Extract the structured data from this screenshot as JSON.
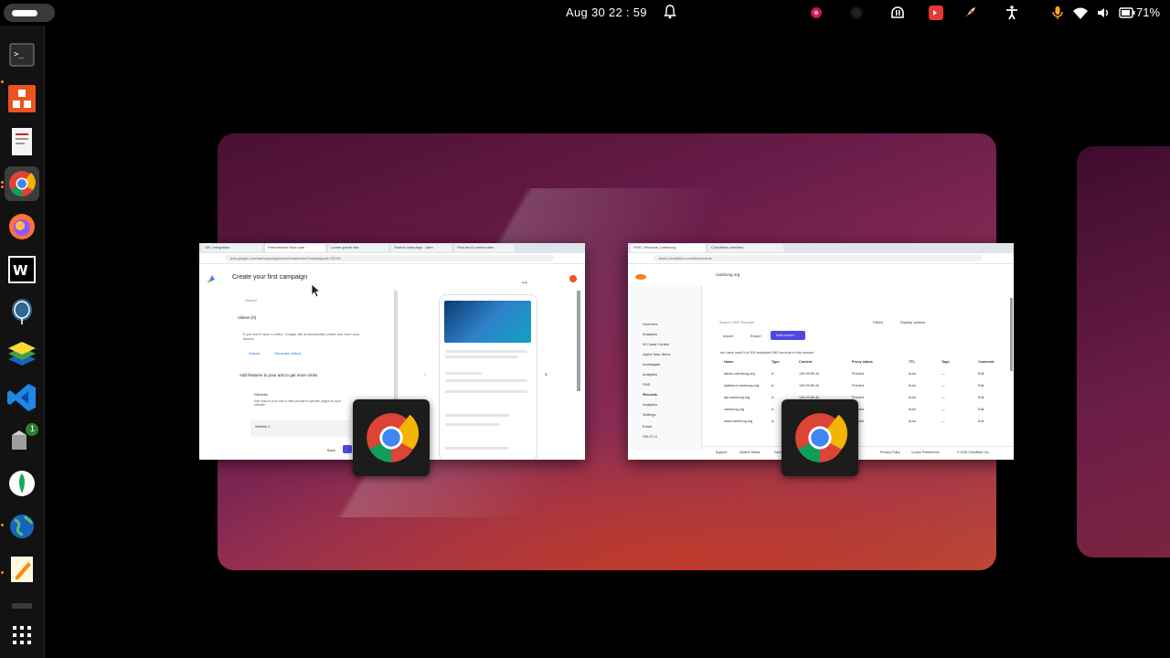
{
  "topbar": {
    "clock": "Aug 30  22 : 59",
    "battery": "71%"
  },
  "dock": {
    "items": [
      "terminal-icon",
      "software-center-icon",
      "document-viewer-icon",
      "chrome-icon",
      "firefox-icon",
      "webstorm-icon",
      "postgresql-icon",
      "layers-app-icon",
      "vscode-icon",
      "software-updater-icon",
      "mongodb-compass-icon",
      "earth-icon",
      "text-editor-icon",
      "drive-icon",
      "show-apps-icon"
    ],
    "updater_badge": "1"
  },
  "window_left": {
    "tabs": [
      "SEL Integration",
      "Performance Max cam",
      "Lorem ipsum site",
      "Search campaign - Adm",
      "Find and & select sites"
    ],
    "url": "ads.google.com/aw/campaigns/new/experiment?campaignId=26798",
    "page_title": "Create your first campaign",
    "help": "Help",
    "search_placeholder": "Search",
    "videos_heading": "Videos (0)",
    "videos_text": "If you don't have a video, Google will automatically create one from your assets",
    "videos_link": "Videos",
    "generate_link": "Generate videos",
    "features_heading": "Add features to your ads to get more clicks",
    "sitelinks": "Sitelinks",
    "sitelinks_text": "Add links to your ads to take people to specific pages on your website.",
    "sitelink_item": "Sitelink 1",
    "back": "Back"
  },
  "window_right": {
    "tabs": [
      "DNS | Records | cambong",
      "Cloudflare overview"
    ],
    "url": "dash.cloudflare.com/dns/records",
    "domain": "cambong.org",
    "search_placeholder": "Search DNS Records",
    "filters": "Filters",
    "display_options": "Display options",
    "import": "Import",
    "export": "Export",
    "add_record": "Add record",
    "notice": "You have used 5 of 200 available DNS records in this domain.",
    "columns": [
      "Name",
      "Type",
      "Content",
      "Proxy status",
      "TTL",
      "Tags",
      "Comment"
    ],
    "rows": [
      [
        "admin.cambong.org",
        "A",
        "149.99.89.44",
        "Proxied",
        "Auto",
        "—",
        "Edit"
      ],
      [
        "ejabberd.cambong.org",
        "A",
        "149.99.89.44",
        "Proxied",
        "Auto",
        "—",
        "Edit"
      ],
      [
        "api.cambong.org",
        "A",
        "149.99.89.44",
        "Proxied",
        "Auto",
        "—",
        "Edit"
      ],
      [
        "cambong.org",
        "A",
        "149.99.89.44",
        "Proxied",
        "Auto",
        "—",
        "Edit"
      ],
      [
        "www.cambong.org",
        "A",
        "149.99.89.44",
        "Proxied",
        "Auto",
        "—",
        "Edit"
      ]
    ],
    "sidebar": [
      "Overview",
      "Analytics",
      "AI Crawl Control",
      "Agent New Items",
      "Investigate",
      "Analytics",
      "DNS",
      "Records",
      "Analytics",
      "Settings",
      "Email",
      "SSL/TLS"
    ],
    "footer": [
      "Support",
      "System Status",
      "Careers",
      "Privacy Policy",
      "Cookie Preferences",
      "© 2025 Cloudflare, Inc."
    ]
  },
  "colors": {
    "accent": "#4f46e5",
    "cloudflare_orange": "#f38020"
  }
}
